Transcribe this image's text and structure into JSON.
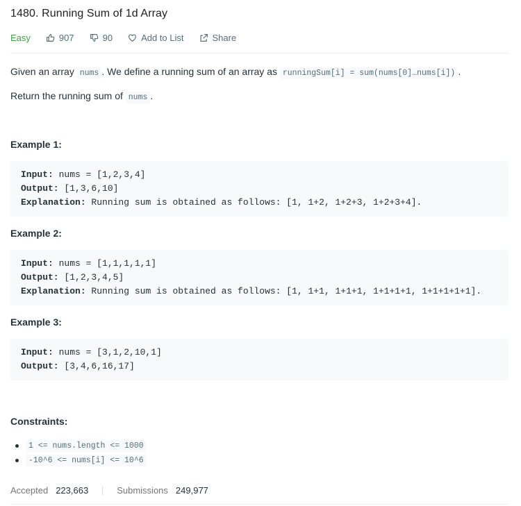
{
  "problem": {
    "title": "1480. Running Sum of 1d Array",
    "difficulty": "Easy",
    "likes": "907",
    "dislikes": "90",
    "add_to_list": "Add to List",
    "share": "Share",
    "colors": {
      "easy": "#43a047",
      "meta": "#546e7a"
    }
  },
  "description": {
    "p1_a": "Given an array ",
    "p1_code1": "nums",
    "p1_b": ". We define a running sum of an array as ",
    "p1_code2": "runningSum[i] = sum(nums[0]…nums[i])",
    "p1_c": ".",
    "p2_a": "Return the running sum of ",
    "p2_code": "nums",
    "p2_b": "."
  },
  "examples": [
    {
      "heading": "Example 1:",
      "input_label": "Input:",
      "input": " nums = [1,2,3,4]",
      "output_label": "Output:",
      "output": " [1,3,6,10]",
      "explanation_label": "Explanation:",
      "explanation": " Running sum is obtained as follows: [1, 1+2, 1+2+3, 1+2+3+4]."
    },
    {
      "heading": "Example 2:",
      "input_label": "Input:",
      "input": " nums = [1,1,1,1,1]",
      "output_label": "Output:",
      "output": " [1,2,3,4,5]",
      "explanation_label": "Explanation:",
      "explanation": " Running sum is obtained as follows: [1, 1+1, 1+1+1, 1+1+1+1, 1+1+1+1+1]."
    },
    {
      "heading": "Example 3:",
      "input_label": "Input:",
      "input": " nums = [3,1,2,10,1]",
      "output_label": "Output:",
      "output": " [3,4,6,16,17]"
    }
  ],
  "constraints": {
    "heading": "Constraints:",
    "items": [
      "1 <= nums.length <= 1000",
      "-10^6 <= nums[i] <= 10^6"
    ]
  },
  "stats": {
    "accepted_label": "Accepted",
    "accepted": "223,663",
    "submissions_label": "Submissions",
    "submissions": "249,977"
  },
  "icons": [
    "thumbs-up-icon",
    "thumbs-down-icon",
    "heart-icon",
    "share-icon"
  ]
}
